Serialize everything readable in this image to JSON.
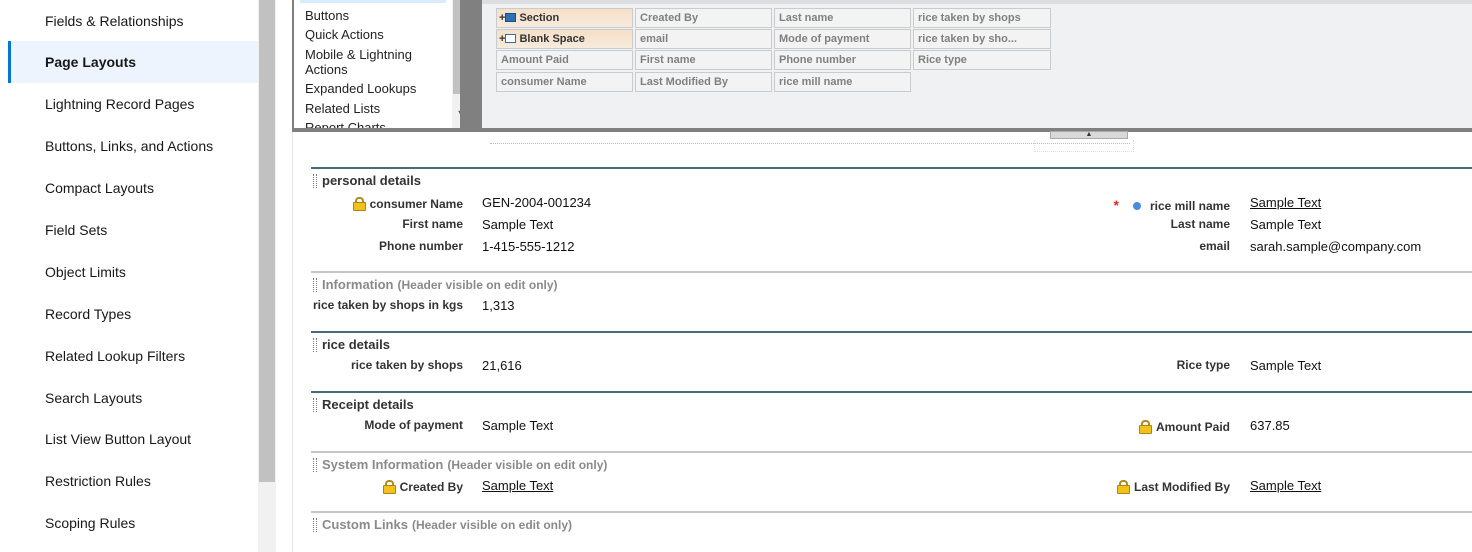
{
  "sidebar": {
    "items": [
      {
        "label": "Fields & Relationships"
      },
      {
        "label": "Page Layouts"
      },
      {
        "label": "Lightning Record Pages"
      },
      {
        "label": "Buttons, Links, and Actions"
      },
      {
        "label": "Compact Layouts"
      },
      {
        "label": "Field Sets"
      },
      {
        "label": "Object Limits"
      },
      {
        "label": "Record Types"
      },
      {
        "label": "Related Lookup Filters"
      },
      {
        "label": "Search Layouts"
      },
      {
        "label": "List View Button Layout"
      },
      {
        "label": "Restriction Rules"
      },
      {
        "label": "Scoping Rules"
      }
    ],
    "active": "Page Layouts"
  },
  "palette": {
    "categories": [
      "Buttons",
      "Quick Actions",
      "Mobile & Lightning\nActions",
      "Expanded Lookups",
      "Related Lists",
      "Report Charts"
    ],
    "fields": [
      [
        "+",
        "Section"
      ],
      [
        "+",
        "Blank Space"
      ],
      "Amount Paid",
      "consumer Name",
      "Created By",
      "email",
      "First name",
      "Last Modified By",
      "Last name",
      "Mode of payment",
      "Phone number",
      "rice mill name",
      "rice taken by shops",
      "rice taken by sho...",
      "Rice type"
    ]
  },
  "sections": {
    "personal": {
      "title": "personal details",
      "consumer_name_label": "consumer Name",
      "consumer_name_value": "GEN-2004-001234",
      "first_name_label": "First name",
      "first_name_value": "Sample Text",
      "phone_label": "Phone number",
      "phone_value": "1-415-555-1212",
      "required_mark": "*",
      "rice_mill_label": "rice mill name",
      "rice_mill_value": "Sample Text",
      "last_name_label": "Last name",
      "last_name_value": "Sample Text",
      "email_label": "email",
      "email_value": "sarah.sample@company.com"
    },
    "information": {
      "title": "Information",
      "note": "(Header visible on edit only)",
      "rice_kgs_label": "rice taken by shops in kgs",
      "rice_kgs_value": "1,313"
    },
    "rice": {
      "title": "rice details",
      "shops_label": "rice taken by shops",
      "shops_value": "21,616",
      "type_label": "Rice type",
      "type_value": "Sample Text"
    },
    "receipt": {
      "title": "Receipt details",
      "mode_label": "Mode of payment",
      "mode_value": "Sample Text",
      "amount_label": "Amount Paid",
      "amount_value": "637.85"
    },
    "system": {
      "title": "System Information",
      "note": "(Header visible on edit only)",
      "created_label": "Created By",
      "created_value": "Sample Text",
      "modified_label": "Last Modified By",
      "modified_value": "Sample Text"
    },
    "links": {
      "title": "Custom Links",
      "note": "(Header visible on edit only)"
    }
  },
  "colors": {
    "active_accent": "#0176d3",
    "active_bg": "#eef4fd",
    "section_rule": "#486b7a",
    "lock": "#f2c21b",
    "required": "#e32727",
    "palette_frame": "#808080"
  },
  "icons": [
    "lock-icon",
    "required-icon",
    "dot-icon",
    "section-icon",
    "blank-space-icon",
    "grip-icon",
    "chevron-up-icon",
    "chevron-down-icon"
  ]
}
